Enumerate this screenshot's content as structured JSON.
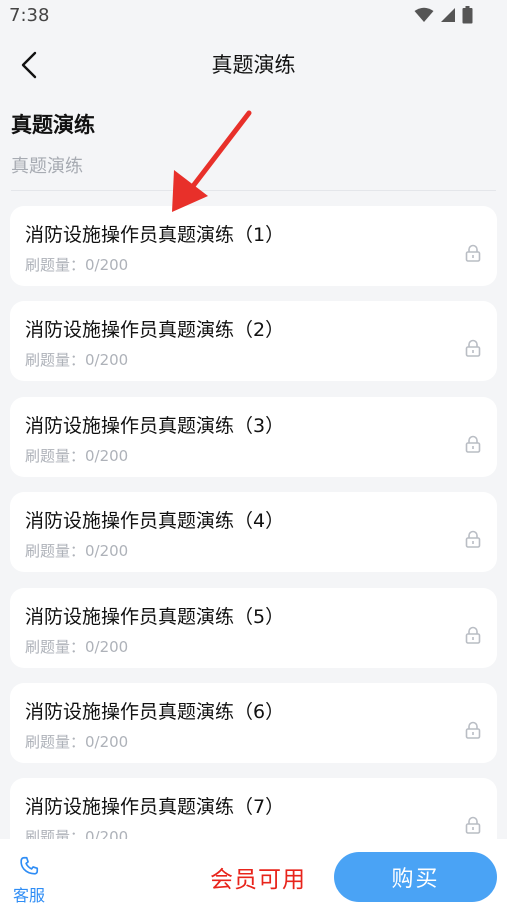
{
  "status_bar": {
    "time": "7:38",
    "icons": [
      "wifi-icon",
      "signal-icon",
      "battery-icon"
    ]
  },
  "nav": {
    "title": "真题演练",
    "back_icon": "chevron-left-icon"
  },
  "section": {
    "title": "真题演练",
    "subtitle": "真题演练"
  },
  "items": [
    {
      "title": "消防设施操作员真题演练（1）",
      "count": "刷题量：0/200",
      "locked": true
    },
    {
      "title": "消防设施操作员真题演练（2）",
      "count": "刷题量：0/200",
      "locked": true
    },
    {
      "title": "消防设施操作员真题演练（3）",
      "count": "刷题量：0/200",
      "locked": true
    },
    {
      "title": "消防设施操作员真题演练（4）",
      "count": "刷题量：0/200",
      "locked": true
    },
    {
      "title": "消防设施操作员真题演练（5）",
      "count": "刷题量：0/200",
      "locked": true
    },
    {
      "title": "消防设施操作员真题演练（6）",
      "count": "刷题量：0/200",
      "locked": true
    },
    {
      "title": "消防设施操作员真题演练（7）",
      "count": "刷题量：0/200",
      "locked": true
    }
  ],
  "bottom_bar": {
    "service_label": "客服",
    "service_icon": "phone-icon",
    "member_text": "会员可用",
    "buy_label": "购买"
  },
  "colors": {
    "accent": "#4aa3f5",
    "member_red": "#e8241b",
    "annotation_red": "#e8302a"
  }
}
